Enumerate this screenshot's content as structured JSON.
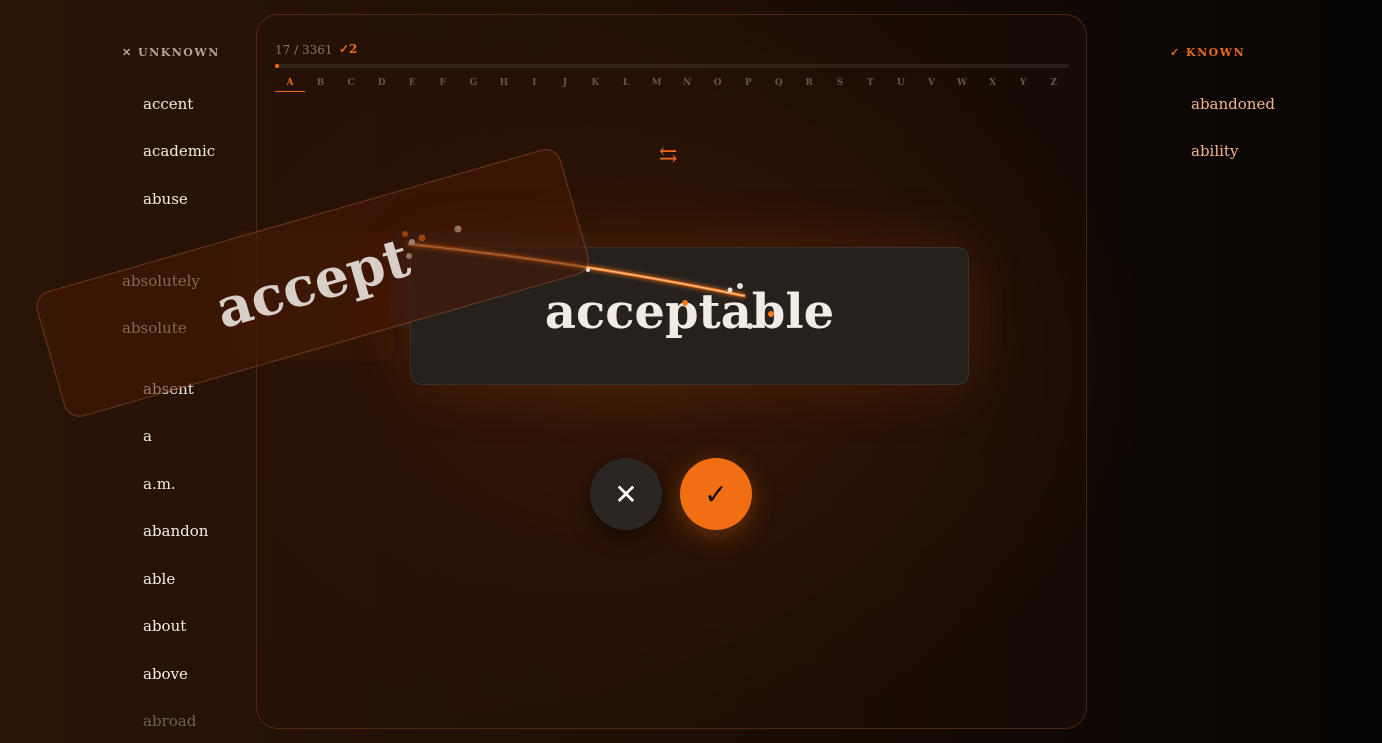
{
  "unknown": {
    "header": "✕ UNKNOWN",
    "items": [
      "accent",
      "academic",
      "abuse",
      "absolutely",
      "absolute",
      "absent",
      "a",
      "a.m.",
      "abandon",
      "able",
      "about",
      "above",
      "abroad"
    ]
  },
  "known": {
    "header": "✓ KNOWN",
    "items": [
      "abandoned",
      "ability"
    ]
  },
  "progress": {
    "text": "17 / 3361",
    "known_count": "✓2",
    "fraction": 0.005
  },
  "alphabet": [
    "A",
    "B",
    "C",
    "D",
    "E",
    "F",
    "G",
    "H",
    "I",
    "J",
    "K",
    "L",
    "M",
    "N",
    "O",
    "P",
    "Q",
    "R",
    "S",
    "T",
    "U",
    "V",
    "W",
    "X",
    "Y",
    "Z"
  ],
  "alphabet_active": "A",
  "swap_icon": "⇆",
  "card": {
    "word": "acceptable"
  },
  "flying_card": {
    "word": "accept"
  },
  "buttons": {
    "reject": "✕",
    "accept": "✓"
  },
  "colors": {
    "accent": "#ee6b1c",
    "card": "#27211e",
    "known_text": "#f3b58b"
  }
}
